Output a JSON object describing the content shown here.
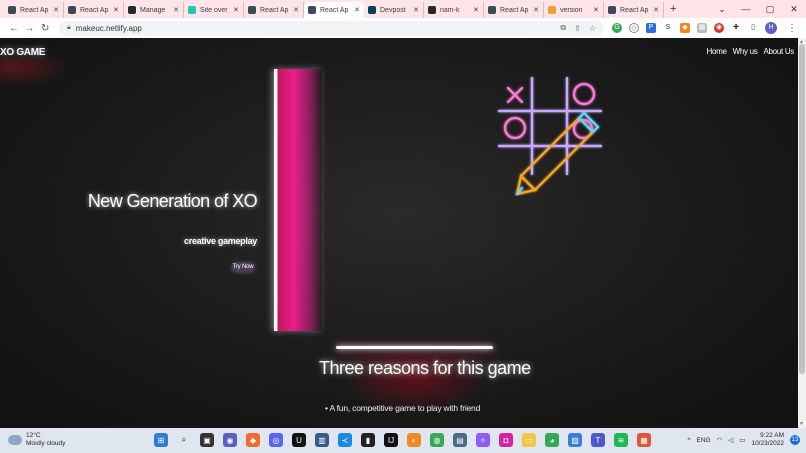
{
  "browser": {
    "tabs": [
      {
        "label": "React Ap",
        "color": "#3d4a5c"
      },
      {
        "label": "React Ap",
        "color": "#3d4a5c"
      },
      {
        "label": "Manage",
        "color": "#24292f"
      },
      {
        "label": "Site over",
        "color": "#20c6b6"
      },
      {
        "label": "React Ap",
        "color": "#3d4a5c"
      },
      {
        "label": "React Ap",
        "color": "#3d4a5c"
      },
      {
        "label": "Devpost",
        "color": "#003e54"
      },
      {
        "label": "nam-k",
        "color": "#24292f"
      },
      {
        "label": "React Ap",
        "color": "#3d4a5c"
      },
      {
        "label": "version",
        "color": "#f0a030"
      },
      {
        "label": "React Ap",
        "color": "#3d4a5c"
      }
    ],
    "active_tab_index": 5,
    "new_tab_symbol": "+",
    "window_controls": {
      "minimize": "—",
      "maximize": "▢",
      "close": "✕",
      "menu": "⌄"
    },
    "url": "makeuc.netlify.app",
    "profile_initial": "H"
  },
  "site": {
    "brand": "XO GAME",
    "nav": [
      {
        "label": "Home"
      },
      {
        "label": "Why us"
      },
      {
        "label": "About Us"
      }
    ],
    "hero": {
      "title": "New Generation of XO",
      "subtitle": "creative gameplay",
      "button": "Try Now"
    },
    "reasons": {
      "title": "Three reasons for this game",
      "items": [
        "• A fun, competitive game to play with friend"
      ]
    }
  },
  "taskbar": {
    "weather_temp": "12°C",
    "weather_desc": "Mostly cloudy",
    "language": "ENG",
    "time": "9:22 AM",
    "date": "10/23/2022",
    "notifications": "13",
    "apps": [
      {
        "name": "windows-start-icon",
        "color": "#2d7dd2",
        "glyph": "⊞"
      },
      {
        "name": "search-icon",
        "color": "#dfe6ef",
        "glyph": "⌕"
      },
      {
        "name": "task-view-icon",
        "color": "#333333",
        "glyph": "▣"
      },
      {
        "name": "chat-icon",
        "color": "#5b5fc7",
        "glyph": "◉"
      },
      {
        "name": "brave-icon",
        "color": "#f26b2a",
        "glyph": "◆"
      },
      {
        "name": "discord-icon",
        "color": "#5865f2",
        "glyph": "◎"
      },
      {
        "name": "unreal-icon",
        "color": "#111111",
        "glyph": "U"
      },
      {
        "name": "jetbrains-icon",
        "color": "#3a5a8c",
        "glyph": "▥"
      },
      {
        "name": "vscode-icon",
        "color": "#1e88e5",
        "glyph": "≺"
      },
      {
        "name": "terminal-icon",
        "color": "#222222",
        "glyph": "▮"
      },
      {
        "name": "intellij-icon",
        "color": "#111111",
        "glyph": "IJ"
      },
      {
        "name": "blender-icon",
        "color": "#f08a24",
        "glyph": "◐"
      },
      {
        "name": "git-client-icon",
        "color": "#3aa757",
        "glyph": "◍"
      },
      {
        "name": "device-icon",
        "color": "#4a6a8a",
        "glyph": "▤"
      },
      {
        "name": "messenger-icon",
        "color": "#8b5cf6",
        "glyph": "✧"
      },
      {
        "name": "instagram-icon",
        "color": "#d6249f",
        "glyph": "◘"
      },
      {
        "name": "file-explorer-icon",
        "color": "#f4c542",
        "glyph": "▭"
      },
      {
        "name": "chrome-icon",
        "color": "#34a853",
        "glyph": "◕"
      },
      {
        "name": "photos-icon",
        "color": "#3b7dd8",
        "glyph": "▧"
      },
      {
        "name": "teams-icon",
        "color": "#5059c9",
        "glyph": "T"
      },
      {
        "name": "spotify-icon",
        "color": "#1db954",
        "glyph": "≋"
      },
      {
        "name": "store-icon",
        "color": "#e0543a",
        "glyph": "▦"
      }
    ]
  },
  "colors": {
    "accent_pink": "#e91e8c",
    "neon_violet": "#c9a8ff",
    "neon_pink": "#ff7ad9",
    "neon_orange": "#f5a623",
    "neon_cyan": "#5ad8ff"
  }
}
